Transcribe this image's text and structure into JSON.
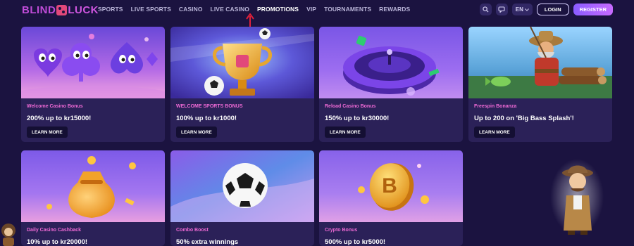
{
  "header": {
    "logo": {
      "left": "BLIND",
      "right": "LUCK"
    },
    "nav": [
      "SPORTS",
      "LIVE SPORTS",
      "CASINO",
      "LIVE CASINO",
      "PROMOTIONS",
      "VIP",
      "TOURNAMENTS",
      "REWARDS"
    ],
    "active_nav": "PROMOTIONS",
    "language": "EN",
    "login_label": "LOGIN",
    "register_label": "REGISTER",
    "icons": [
      "search-icon",
      "chat-icon",
      "chevron-down-icon"
    ]
  },
  "promotions": [
    {
      "tag": "Welcome Casino Bonus",
      "title": "200% up to kr15000!",
      "button": "LEARN MORE",
      "art": "card-suit-characters"
    },
    {
      "tag": "WELCOME SPORTS BONUS",
      "title": "100% up to kr1000!",
      "button": "LEARN MORE",
      "art": "trophy-football"
    },
    {
      "tag": "Reload Casino Bonus",
      "title": "150% up to kr30000!",
      "button": "LEARN MORE",
      "art": "roulette-wheel"
    },
    {
      "tag": "Freespin Bonanza",
      "title": "Up to 200 on 'Big Bass Splash'!",
      "button": "LEARN MORE",
      "art": "fisherman"
    },
    {
      "tag": "Daily Casino Cashback",
      "title": "10% up to kr20000!",
      "art": "money-bag"
    },
    {
      "tag": "Combo Boost",
      "title": "50% extra winnings",
      "art": "football"
    },
    {
      "tag": "Crypto Bonus",
      "title": "500% up to kr5000!",
      "art": "bitcoin-coin"
    }
  ],
  "colors": {
    "background": "#1b1340",
    "card": "#2b2158",
    "tag": "#f06ad6",
    "accent": "#8a5cff"
  }
}
